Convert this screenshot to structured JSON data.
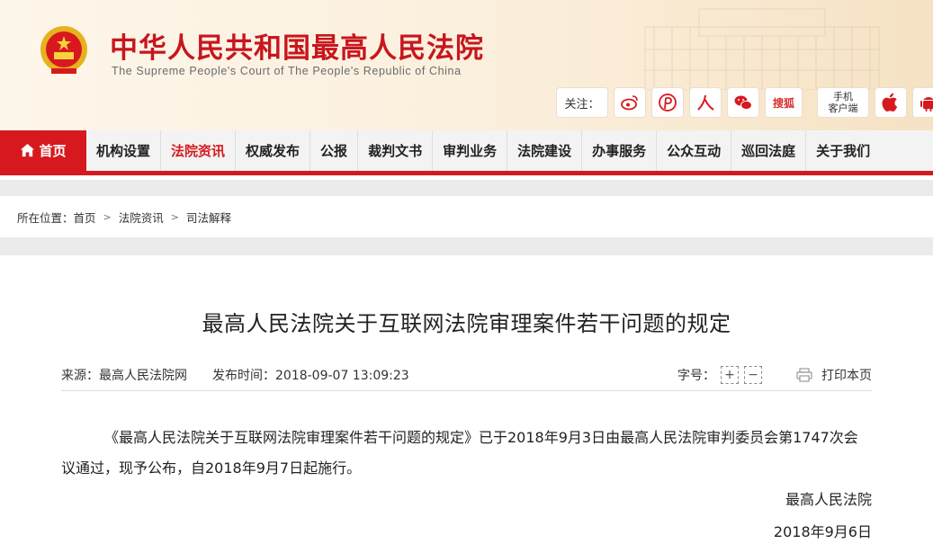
{
  "header": {
    "title": "中华人民共和国最高人民法院",
    "subtitle": "The Supreme People's Court of The People's Republic of China",
    "emblem_icon": "national-emblem-icon",
    "follow_label": "关注：",
    "social": [
      {
        "name": "weibo-icon"
      },
      {
        "name": "people-daily-icon"
      },
      {
        "name": "renmin-icon"
      },
      {
        "name": "wechat-icon"
      },
      {
        "label": "搜狐"
      },
      {
        "label": "手机\n客户端"
      },
      {
        "name": "apple-icon"
      },
      {
        "name": "android-icon"
      }
    ],
    "sohu_label": "搜狐",
    "mobile_label": "手机客户端",
    "mobile_line1": "手机",
    "mobile_line2": "客户端"
  },
  "nav": {
    "home": "首页",
    "items": [
      "机构设置",
      "法院资讯",
      "权威发布",
      "公报",
      "裁判文书",
      "审判业务",
      "法院建设",
      "办事服务",
      "公众互动",
      "巡回法庭",
      "关于我们"
    ],
    "active_index": 1
  },
  "breadcrumb": {
    "prefix": "所在位置：",
    "items": [
      "首页",
      "法院资讯",
      "司法解释"
    ]
  },
  "article": {
    "title": "最高人民法院关于互联网法院审理案件若干问题的规定",
    "source": "来源：最高人民法院网",
    "published": "发布时间：2018-09-07 13:09:23",
    "font_size_label": "字号：",
    "font_plus": "+",
    "font_minus": "−",
    "print_label": "打印本页",
    "body": "《最高人民法院关于互联网法院审理案件若干问题的规定》已于2018年9月3日由最高人民法院审判委员会第1747次会议通过，现予公布，自2018年9月7日起施行。",
    "sign_org": "最高人民法院",
    "sign_date": "2018年9月6日"
  },
  "colors": {
    "brand_red": "#d7191f",
    "header_bg": "#fbefdc"
  }
}
